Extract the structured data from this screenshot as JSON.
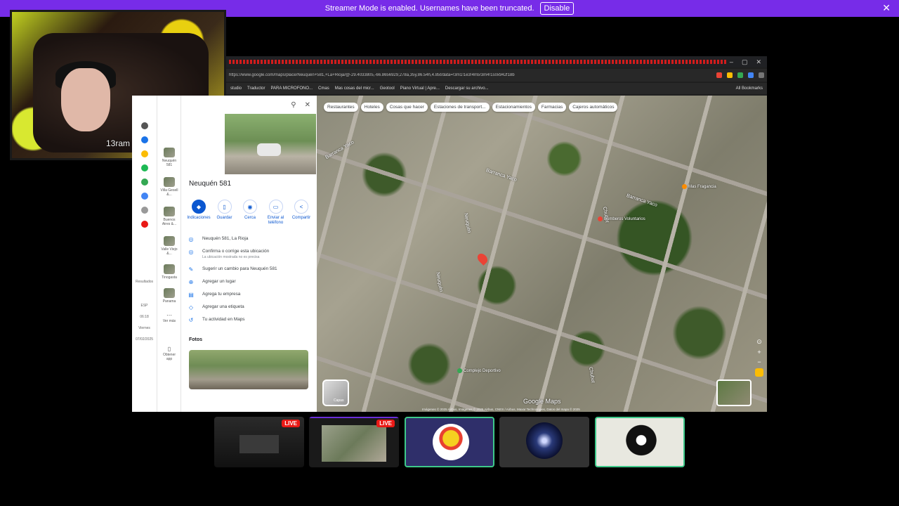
{
  "banner": {
    "message": "Streamer Mode is enabled. Usernames have been truncated.",
    "button": "Disable",
    "close": "✕"
  },
  "webcam": {
    "overlay_text": "13ram"
  },
  "browser": {
    "window_controls": [
      "–",
      "▢",
      "✕"
    ],
    "url": "https://www.google.com/maps/place/Neuquén+581,+La+Rioja/@-29.4033805,-66.8656929,278a,35y,86.54h,4.85t/data=!3m1!1e3!4m5!3m4!1s0x942f18b",
    "bookmarks": [
      "studio",
      "Traductor",
      "PARA MICROFONO...",
      "Cmas",
      "Mas cosas del micr...",
      "Geotool",
      "Piano Virtual | Apre...",
      "Descargar su archivo..."
    ],
    "all_bookmarks": "All Bookmarks"
  },
  "rail": {
    "labels": [
      "Resultados"
    ],
    "footer": [
      "ESP",
      "06:18",
      "Viernes",
      "07/02/2025"
    ]
  },
  "recents": [
    {
      "label": "Neuquén 581"
    },
    {
      "label": "Villa Gesell &..."
    },
    {
      "label": "Buenos Aires &..."
    },
    {
      "label": "Valle Viejo &..."
    },
    {
      "label": "Tinogasta"
    },
    {
      "label": "Panama"
    },
    {
      "label": "Ver más"
    },
    {
      "label": "Obtener app"
    }
  ],
  "panel": {
    "title": "Neuquén 581",
    "actions": [
      {
        "label": "Indicaciones",
        "icon": "◆"
      },
      {
        "label": "Guardar",
        "icon": "▯"
      },
      {
        "label": "Cerca",
        "icon": "◉"
      },
      {
        "label": "Enviar al teléfono",
        "icon": "▭"
      },
      {
        "label": "Compartir",
        "icon": "<"
      }
    ],
    "info": [
      {
        "icon": "location-pin-icon",
        "glyph": "◎",
        "text": "Neuquén 581, La Rioja",
        "sub": ""
      },
      {
        "icon": "verify-location-icon",
        "glyph": "◎",
        "text": "Confirma o corrige esta ubicación",
        "sub": "La ubicación mostrada no es precisa"
      },
      {
        "icon": "edit-icon",
        "glyph": "✎",
        "text": "Sugerir un cambio para Neuquén 581",
        "sub": ""
      },
      {
        "icon": "add-place-icon",
        "glyph": "⊕",
        "text": "Agregar un lugar",
        "sub": ""
      },
      {
        "icon": "business-icon",
        "glyph": "▤",
        "text": "Agrega tu empresa",
        "sub": ""
      },
      {
        "icon": "label-icon",
        "glyph": "◇",
        "text": "Agregar una etiqueta",
        "sub": ""
      },
      {
        "icon": "history-icon",
        "glyph": "↺",
        "text": "Tu actividad en Maps",
        "sub": ""
      }
    ],
    "photos_title": "Fotos"
  },
  "map": {
    "chips": [
      "Restaurantes",
      "Hoteles",
      "Cosas que hacer",
      "Estaciones de transport...",
      "Estacionamientos",
      "Farmacias",
      "Cajeros automáticos"
    ],
    "streets": [
      "Barranca Yaco",
      "Barranca Yaco",
      "Neuquén",
      "Neuquén",
      "Chubut",
      "Chubut",
      "Barranca Yaco"
    ],
    "pois": [
      "Bomberos Voluntarios",
      "Mas Fragancia",
      "Complejo Deportivo"
    ],
    "layers_label": "Capas",
    "google_logo": "Google Maps",
    "attribution": "Imágenes © 2025 Airbus, Imágenes © 2025 Airbus, CNES / Airbus, Maxar Technologies, Datos del mapa © 2025"
  },
  "overlays": [
    {
      "live": "LIVE"
    },
    {
      "live": "LIVE"
    }
  ],
  "colors": {
    "banner": "#772ce8",
    "live": "#e91916",
    "maps_blue": "#0b57d0",
    "pin": "#ea4335"
  }
}
